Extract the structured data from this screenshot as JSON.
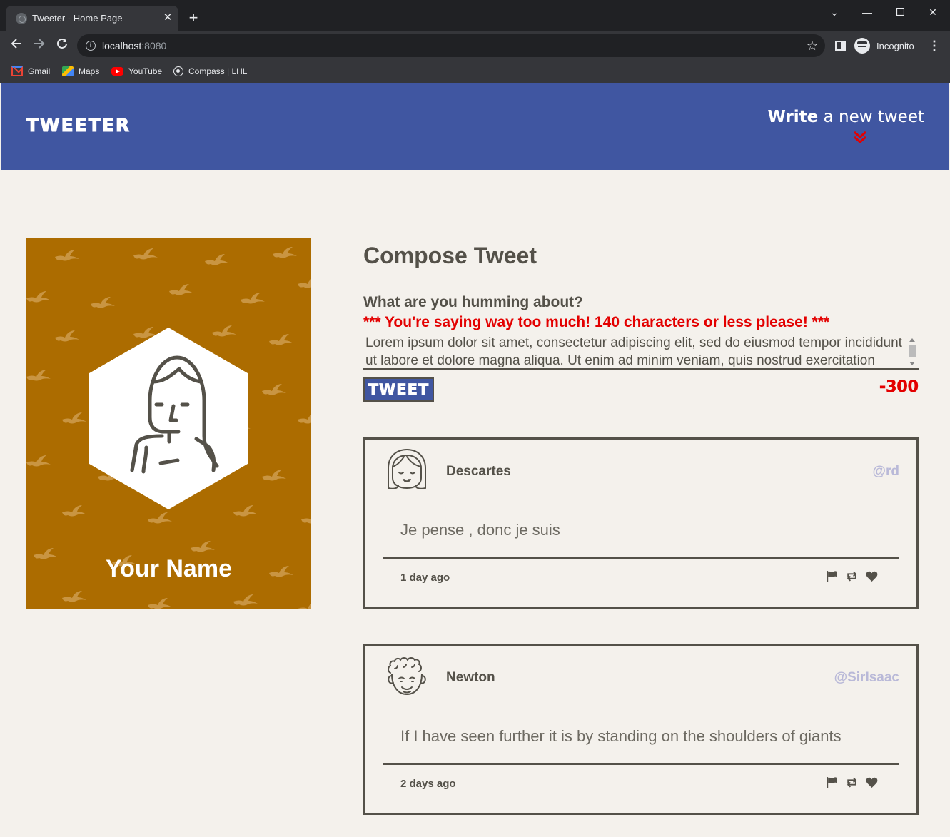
{
  "browser": {
    "tab_title": "Tweeter - Home Page",
    "url_host": "localhost",
    "url_port": ":8080",
    "profile_label": "Incognito",
    "bookmarks": [
      "Gmail",
      "Maps",
      "YouTube",
      "Compass | LHL"
    ]
  },
  "header": {
    "brand": "TWEETER",
    "write_bold": "Write",
    "write_rest": " a new tweet",
    "accent_color": "#e30000"
  },
  "profile": {
    "name": "Your Name",
    "background_color": "#ac6c00"
  },
  "compose": {
    "title": "Compose Tweet",
    "label": "What are you humming about?",
    "error": "*** You're saying way too much! 140 characters or less please! ***",
    "textarea_value": "Lorem ipsum dolor sit amet, consectetur adipiscing elit, sed do eiusmod tempor incididunt ut labore et dolore magna aliqua. Ut enim ad minim veniam, quis nostrud exercitation ullamco laboris nisi ut aliquip ex ea commodo consequat.",
    "button_label": "TWEET",
    "counter": "-300"
  },
  "tweets": [
    {
      "name": "Descartes",
      "handle": "@rd",
      "content": "Je pense , donc je suis",
      "time": "1 day ago",
      "avatar": "girl-avatar-icon"
    },
    {
      "name": "Newton",
      "handle": "@SirIsaac",
      "content": "If I have seen further it is by standing on the shoulders of giants",
      "time": "2 days ago",
      "avatar": "curly-hair-avatar-icon"
    }
  ],
  "icons": {
    "actions": [
      "flag-icon",
      "retweet-icon",
      "heart-icon"
    ]
  }
}
